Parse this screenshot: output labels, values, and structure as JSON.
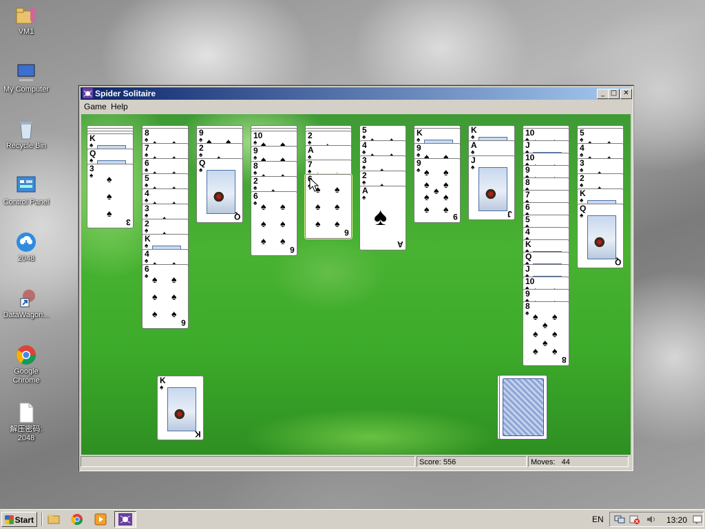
{
  "desktop": {
    "icons": [
      {
        "label": "VM1"
      },
      {
        "label": "My Computer"
      },
      {
        "label": "Recycle Bin"
      },
      {
        "label": "Control Panel"
      },
      {
        "label": "2048"
      },
      {
        "label": "DataWagon..."
      },
      {
        "label": "Google Chrome"
      },
      {
        "label": "解压密码:\n2048"
      }
    ]
  },
  "window": {
    "title": "Spider Solitaire",
    "buttons": {
      "minimize": "_",
      "maximize": "□",
      "close": "✕"
    },
    "menu": [
      "Game",
      "Help"
    ],
    "status": {
      "score_label": "Score:",
      "score": "556",
      "moves_label": "Moves:",
      "moves": "44"
    }
  },
  "tableau": [
    {
      "hidden": 3,
      "faceup": [
        "K",
        "Q"
      ],
      "tail": [
        "3"
      ]
    },
    {
      "hidden": 1,
      "faceup": [
        "8",
        "7",
        "6",
        "5",
        "4",
        "3",
        "2",
        "K",
        "4",
        "6"
      ]
    },
    {
      "hidden": 1,
      "faceup": [
        "9",
        "2",
        "Q"
      ]
    },
    {
      "hidden": 2,
      "faceup": [
        "10",
        "9",
        "8",
        "2",
        "6"
      ]
    },
    {
      "hidden": 2,
      "faceup": [
        "2",
        "A",
        "7",
        "6"
      ]
    },
    {
      "hidden": 0,
      "faceup": [
        "5",
        "4",
        "3",
        "2",
        "A"
      ]
    },
    {
      "hidden": 1,
      "faceup": [
        "K",
        "9",
        "9"
      ]
    },
    {
      "hidden": 0,
      "faceup": [
        "K",
        "A",
        "J"
      ]
    },
    {
      "hidden": 1,
      "faceup": [
        "10",
        "J",
        "10",
        "9",
        "8",
        "7",
        "6",
        "5",
        "4",
        "K",
        "Q",
        "J",
        "10",
        "9",
        "8"
      ]
    },
    {
      "hidden": 1,
      "faceup": [
        "5",
        "4",
        "3",
        "2",
        "K",
        "Q"
      ]
    }
  ],
  "foundation": {
    "completed_suit_top": "K"
  },
  "stock": {
    "piles": 2
  },
  "suit": "♠",
  "taskbar": {
    "start_label": "Start",
    "language": "EN",
    "clock": "13:20"
  },
  "colors": {
    "felt": "#44a832",
    "title_start": "#0a246a",
    "title_end": "#a6caf0"
  }
}
